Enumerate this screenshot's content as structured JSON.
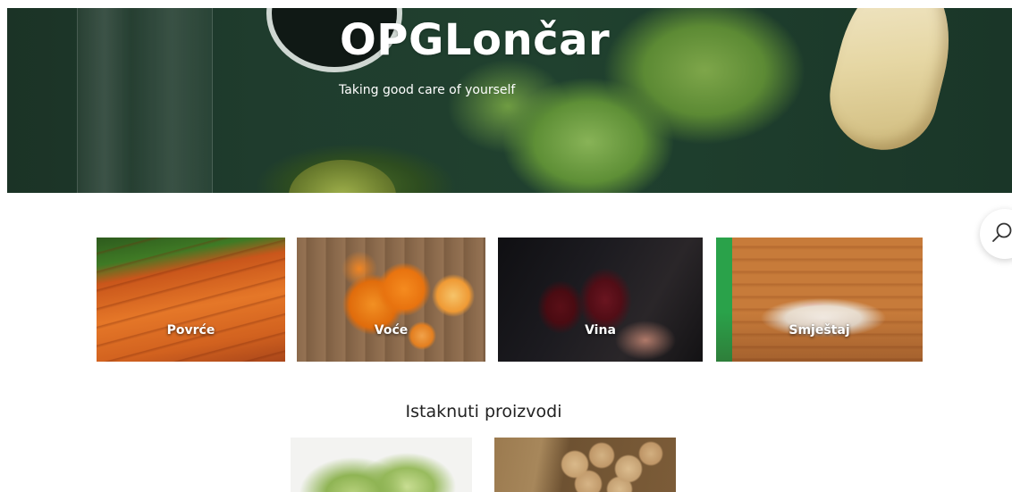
{
  "hero": {
    "title": "OPGLončar",
    "tagline": "Taking good care of yourself"
  },
  "search": {
    "icon": "search-icon"
  },
  "categories": [
    {
      "label": "Povrće"
    },
    {
      "label": "Voće"
    },
    {
      "label": "Vina"
    },
    {
      "label": "Smještaj"
    }
  ],
  "featured": {
    "title": "Istaknuti proizvodi"
  }
}
